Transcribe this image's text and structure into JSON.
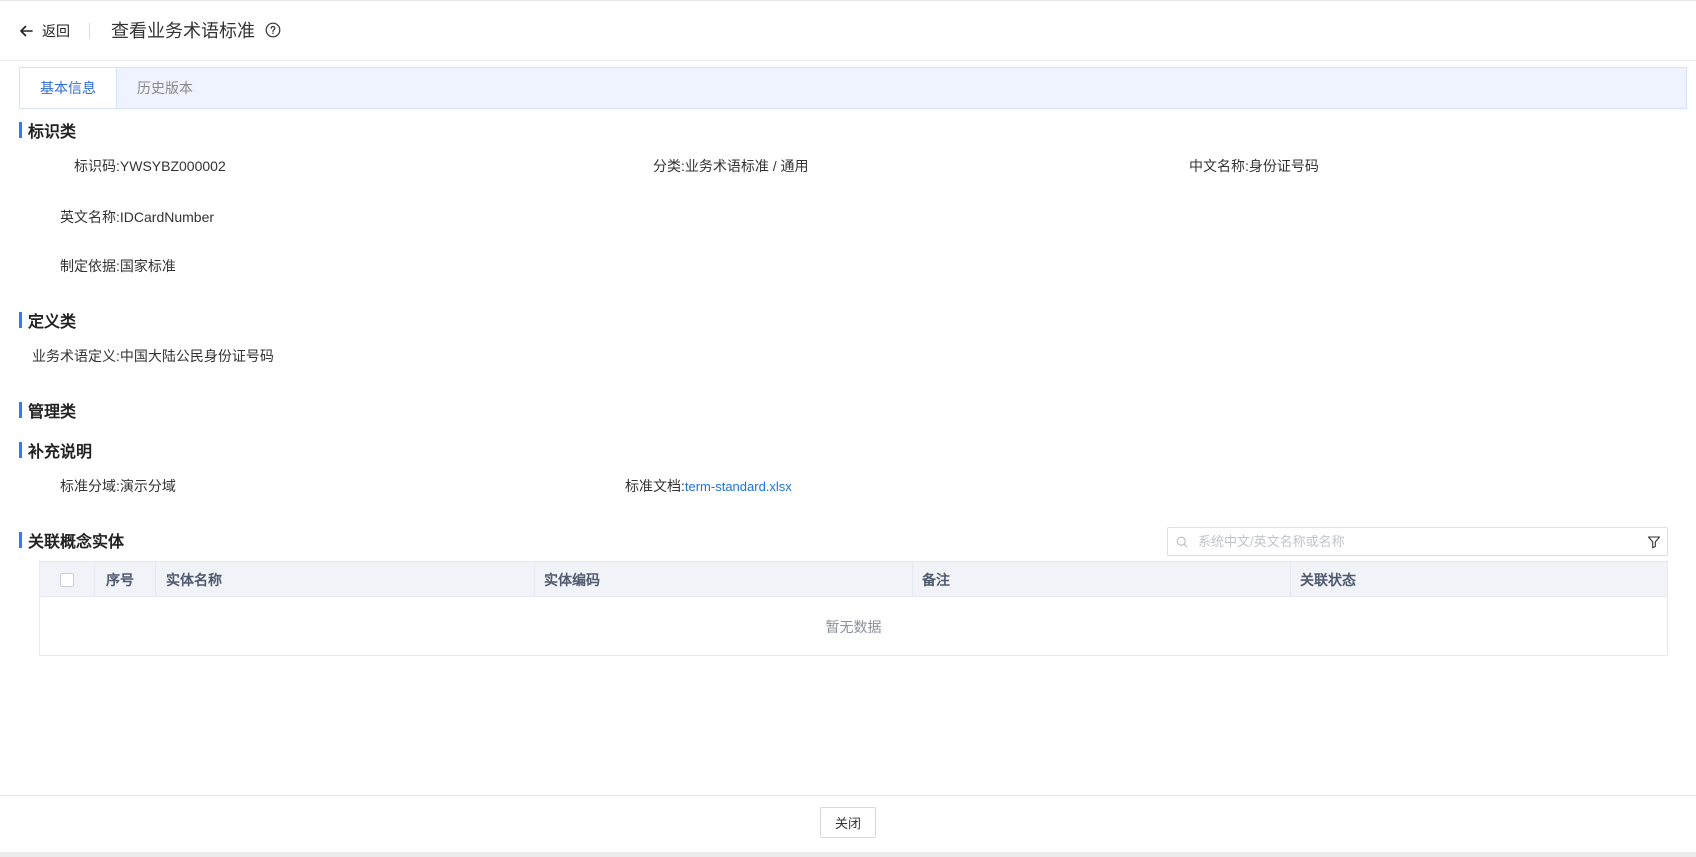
{
  "header": {
    "back_label": "返回",
    "title": "查看业务术语标准"
  },
  "tabs": [
    {
      "label": "基本信息",
      "active": true
    },
    {
      "label": "历史版本",
      "active": false
    }
  ],
  "sections": {
    "identity": {
      "title": "标识类",
      "code_label": "标识码:",
      "code_value": "YWSYBZ000002",
      "category_label": "分类:",
      "category_value": "业务术语标准 / 通用",
      "cn_name_label": "中文名称:",
      "cn_name_value": "身份证号码",
      "en_name_label": "英文名称:",
      "en_name_value": "IDCardNumber",
      "basis_label": "制定依据:",
      "basis_value": "国家标准"
    },
    "definition": {
      "title": "定义类",
      "def_label": "业务术语定义:",
      "def_value": "中国大陆公民身份证号码"
    },
    "management": {
      "title": "管理类"
    },
    "supplement": {
      "title": "补充说明",
      "domain_label": "标准分域:",
      "domain_value": "演示分域",
      "doc_label": "标准文档:",
      "doc_value": "term-standard.xlsx"
    },
    "related": {
      "title": "关联概念实体",
      "search_placeholder": "系统中文/英文名称或名称",
      "columns": [
        "序号",
        "实体名称",
        "实体编码",
        "备注",
        "关联状态"
      ],
      "empty_text": "暂无数据"
    }
  },
  "footer": {
    "close_label": "关闭"
  },
  "colors": {
    "accent": "#2f7cf6",
    "link": "#1a73e8",
    "tab_bg": "#eef3ff"
  }
}
